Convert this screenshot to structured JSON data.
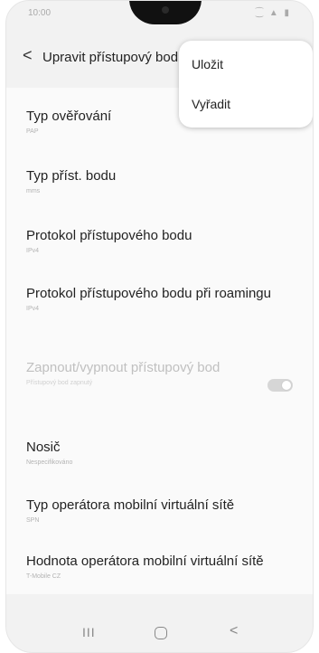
{
  "status_bar": {
    "time": "10:00",
    "icons": "⁐ ▲ ▮"
  },
  "header": {
    "back_icon": "<",
    "title": "Upravit přístupový bod"
  },
  "menu": {
    "items": [
      "Uložit",
      "Vyřadit"
    ]
  },
  "settings": [
    {
      "title": "Typ ověřování",
      "value": "PAP"
    },
    {
      "title": "Typ příst. bodu",
      "value": "mms"
    },
    {
      "title": "Protokol přístupového bodu",
      "value": "IPv4"
    },
    {
      "title": "Protokol přístupového bodu při roamingu",
      "value": "IPv4"
    },
    {
      "title": "Zapnout/vypnout přístupový bod",
      "value": "Přístupový bod zapnutý",
      "enabled": false
    },
    {
      "title": "Nosič",
      "value": "Nespecifikováno"
    },
    {
      "title": "Typ operátora mobilní virtuální sítě",
      "value": "SPN"
    },
    {
      "title": "Hodnota operátora mobilní virtuální sítě",
      "value": "T-Mobile CZ"
    }
  ],
  "nav_bar": {
    "recent": "III",
    "back": "<"
  }
}
